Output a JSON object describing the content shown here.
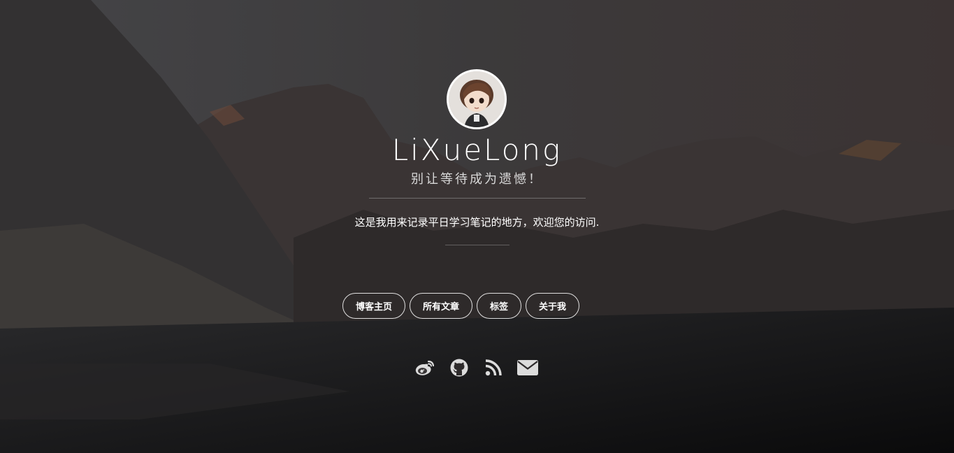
{
  "profile": {
    "name": "LiXueLong",
    "motto": "别让等待成为遗憾！",
    "description": "这是我用来记录平日学习笔记的地方，欢迎您的访问."
  },
  "nav": {
    "items": [
      {
        "label": "博客主页"
      },
      {
        "label": "所有文章"
      },
      {
        "label": "标签"
      },
      {
        "label": "关于我"
      }
    ]
  },
  "social": {
    "icons": [
      "weibo-icon",
      "github-icon",
      "rss-icon",
      "email-icon"
    ]
  },
  "colors": {
    "text": "#ffffff",
    "subtitle": "#d8d8d8",
    "icon": "#dcdcdc"
  }
}
